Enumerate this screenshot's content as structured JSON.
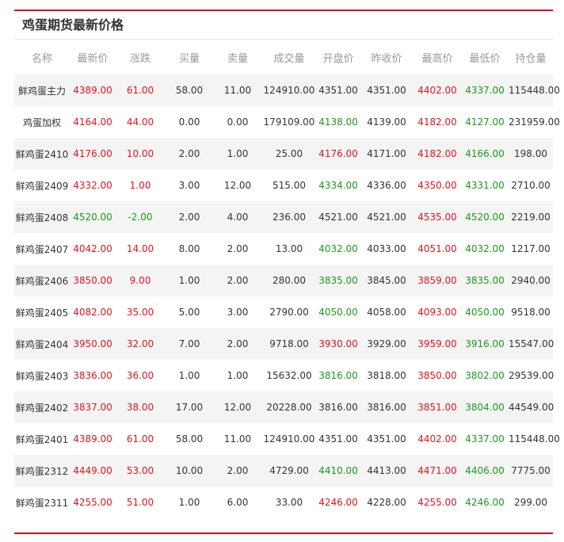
{
  "title": "鸡蛋期货最新价格",
  "headers": [
    "名称",
    "最新价",
    "涨跌",
    "买量",
    "卖量",
    "成交量",
    "开盘价",
    "昨收价",
    "最高价",
    "最低价",
    "持仓量"
  ],
  "colors": {
    "up": "#e3141d",
    "down": "#1a9b1a",
    "neutral": "#333333",
    "accent": "#d0111b"
  },
  "rows": [
    {
      "name": "鲜鸡蛋主力",
      "last": "4389.00",
      "change": "61.00",
      "bid": "58.00",
      "ask": "11.00",
      "volume": "124910.00",
      "open": "4351.00",
      "prev": "4351.00",
      "high": "4402.00",
      "low": "4337.00",
      "oi": "115448.00",
      "c": {
        "last": "up",
        "change": "up",
        "open": "neu",
        "high": "up",
        "low": "down"
      }
    },
    {
      "name": "鸡蛋加权",
      "last": "4164.00",
      "change": "44.00",
      "bid": "0.00",
      "ask": "0.00",
      "volume": "179109.00",
      "open": "4138.00",
      "prev": "4139.00",
      "high": "4182.00",
      "low": "4127.00",
      "oi": "231959.00",
      "c": {
        "last": "up",
        "change": "up",
        "open": "down",
        "high": "up",
        "low": "down"
      }
    },
    {
      "name": "鲜鸡蛋2410",
      "last": "4176.00",
      "change": "10.00",
      "bid": "2.00",
      "ask": "1.00",
      "volume": "25.00",
      "open": "4176.00",
      "prev": "4171.00",
      "high": "4182.00",
      "low": "4166.00",
      "oi": "198.00",
      "c": {
        "last": "up",
        "change": "up",
        "open": "up",
        "high": "up",
        "low": "down"
      }
    },
    {
      "name": "鲜鸡蛋2409",
      "last": "4332.00",
      "change": "1.00",
      "bid": "3.00",
      "ask": "12.00",
      "volume": "515.00",
      "open": "4334.00",
      "prev": "4336.00",
      "high": "4350.00",
      "low": "4331.00",
      "oi": "2710.00",
      "c": {
        "last": "up",
        "change": "up",
        "open": "down",
        "high": "up",
        "low": "down"
      }
    },
    {
      "name": "鲜鸡蛋2408",
      "last": "4520.00",
      "change": "-2.00",
      "bid": "2.00",
      "ask": "4.00",
      "volume": "236.00",
      "open": "4521.00",
      "prev": "4521.00",
      "high": "4535.00",
      "low": "4520.00",
      "oi": "2219.00",
      "c": {
        "last": "down",
        "change": "down",
        "open": "neu",
        "high": "up",
        "low": "down"
      }
    },
    {
      "name": "鲜鸡蛋2407",
      "last": "4042.00",
      "change": "14.00",
      "bid": "8.00",
      "ask": "2.00",
      "volume": "13.00",
      "open": "4032.00",
      "prev": "4033.00",
      "high": "4051.00",
      "low": "4032.00",
      "oi": "1217.00",
      "c": {
        "last": "up",
        "change": "up",
        "open": "down",
        "high": "up",
        "low": "down"
      }
    },
    {
      "name": "鲜鸡蛋2406",
      "last": "3850.00",
      "change": "9.00",
      "bid": "1.00",
      "ask": "2.00",
      "volume": "280.00",
      "open": "3835.00",
      "prev": "3845.00",
      "high": "3859.00",
      "low": "3835.00",
      "oi": "2940.00",
      "c": {
        "last": "up",
        "change": "up",
        "open": "down",
        "high": "up",
        "low": "down"
      }
    },
    {
      "name": "鲜鸡蛋2405",
      "last": "4082.00",
      "change": "35.00",
      "bid": "5.00",
      "ask": "3.00",
      "volume": "2790.00",
      "open": "4050.00",
      "prev": "4058.00",
      "high": "4093.00",
      "low": "4050.00",
      "oi": "9518.00",
      "c": {
        "last": "up",
        "change": "up",
        "open": "down",
        "high": "up",
        "low": "down"
      }
    },
    {
      "name": "鲜鸡蛋2404",
      "last": "3950.00",
      "change": "32.00",
      "bid": "7.00",
      "ask": "2.00",
      "volume": "9718.00",
      "open": "3930.00",
      "prev": "3929.00",
      "high": "3959.00",
      "low": "3916.00",
      "oi": "15547.00",
      "c": {
        "last": "up",
        "change": "up",
        "open": "up",
        "high": "up",
        "low": "down"
      }
    },
    {
      "name": "鲜鸡蛋2403",
      "last": "3836.00",
      "change": "36.00",
      "bid": "1.00",
      "ask": "1.00",
      "volume": "15632.00",
      "open": "3816.00",
      "prev": "3818.00",
      "high": "3850.00",
      "low": "3802.00",
      "oi": "29539.00",
      "c": {
        "last": "up",
        "change": "up",
        "open": "down",
        "high": "up",
        "low": "down"
      }
    },
    {
      "name": "鲜鸡蛋2402",
      "last": "3837.00",
      "change": "38.00",
      "bid": "17.00",
      "ask": "12.00",
      "volume": "20228.00",
      "open": "3816.00",
      "prev": "3816.00",
      "high": "3851.00",
      "low": "3804.00",
      "oi": "44549.00",
      "c": {
        "last": "up",
        "change": "up",
        "open": "neu",
        "high": "up",
        "low": "down"
      }
    },
    {
      "name": "鲜鸡蛋2401",
      "last": "4389.00",
      "change": "61.00",
      "bid": "58.00",
      "ask": "11.00",
      "volume": "124910.00",
      "open": "4351.00",
      "prev": "4351.00",
      "high": "4402.00",
      "low": "4337.00",
      "oi": "115448.00",
      "c": {
        "last": "up",
        "change": "up",
        "open": "neu",
        "high": "up",
        "low": "down"
      }
    },
    {
      "name": "鲜鸡蛋2312",
      "last": "4449.00",
      "change": "53.00",
      "bid": "10.00",
      "ask": "2.00",
      "volume": "4729.00",
      "open": "4410.00",
      "prev": "4413.00",
      "high": "4471.00",
      "low": "4406.00",
      "oi": "7775.00",
      "c": {
        "last": "up",
        "change": "up",
        "open": "down",
        "high": "up",
        "low": "down"
      }
    },
    {
      "name": "鲜鸡蛋2311",
      "last": "4255.00",
      "change": "51.00",
      "bid": "1.00",
      "ask": "6.00",
      "volume": "33.00",
      "open": "4246.00",
      "prev": "4228.00",
      "high": "4255.00",
      "low": "4246.00",
      "oi": "299.00",
      "c": {
        "last": "up",
        "change": "up",
        "open": "up",
        "high": "up",
        "low": "down"
      }
    }
  ]
}
